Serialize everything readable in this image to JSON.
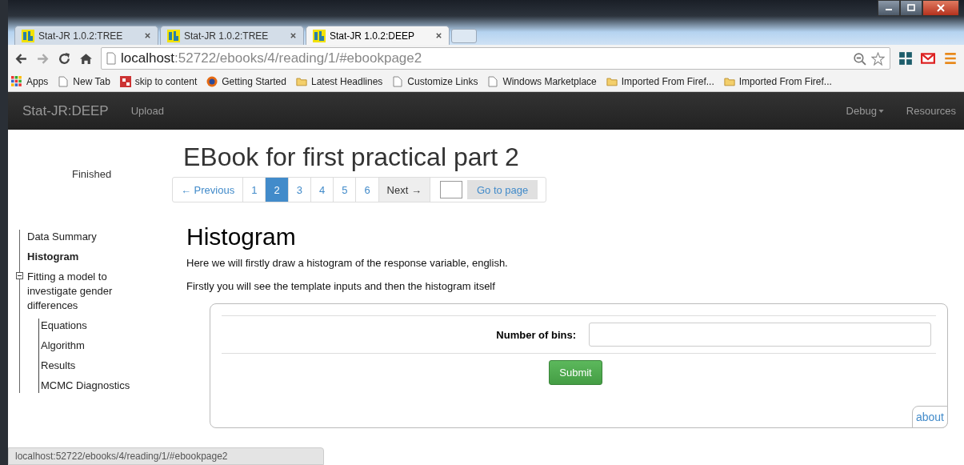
{
  "browser": {
    "tabs": [
      {
        "title": "Stat-JR 1.0.2:TREE",
        "selected": false
      },
      {
        "title": "Stat-JR 1.0.2:TREE",
        "selected": false
      },
      {
        "title": "Stat-JR 1.0.2:DEEP",
        "selected": true
      }
    ],
    "address": {
      "host": "localhost",
      "rest": ":52722/ebooks/4/reading/1/#ebookpage2"
    },
    "bookmarks": [
      {
        "label": "Apps",
        "kind": "apps"
      },
      {
        "label": "New Tab",
        "kind": "page"
      },
      {
        "label": "skip to content",
        "kind": "site"
      },
      {
        "label": "Getting Started",
        "kind": "firefox"
      },
      {
        "label": "Latest Headlines",
        "kind": "folder"
      },
      {
        "label": "Customize Links",
        "kind": "page"
      },
      {
        "label": "Windows Marketplace",
        "kind": "page"
      },
      {
        "label": "Imported From Firef...",
        "kind": "folder"
      },
      {
        "label": "Imported From Firef...",
        "kind": "folder"
      }
    ],
    "status_bar": "localhost:52722/ebooks/4/reading/1/#ebookpage2"
  },
  "navbar": {
    "brand": "Stat-JR:DEEP",
    "left": [
      "Upload"
    ],
    "right": [
      {
        "label": "Debug",
        "dropdown": true
      },
      {
        "label": "Resources",
        "dropdown": false
      }
    ]
  },
  "sidebar": {
    "status": "Finished",
    "tree": [
      {
        "label": "Data Summary",
        "selected": false
      },
      {
        "label": "Histogram",
        "selected": true
      },
      {
        "label": "Fitting a model to investigate gender differences",
        "selected": false,
        "expanded": true,
        "children": [
          {
            "label": "Equations",
            "selected": false
          },
          {
            "label": "Algorithm",
            "selected": false
          },
          {
            "label": "Results",
            "selected": false
          },
          {
            "label": "MCMC Diagnostics",
            "selected": false
          }
        ]
      }
    ]
  },
  "ebook": {
    "title": "EBook for first practical part 2",
    "pagination": [
      {
        "label": "← Previous",
        "selected": false,
        "shaded": false
      },
      {
        "label": "1",
        "selected": false,
        "shaded": false
      },
      {
        "label": "2",
        "selected": true,
        "shaded": false
      },
      {
        "label": "3",
        "selected": false,
        "shaded": false
      },
      {
        "label": "4",
        "selected": false,
        "shaded": false
      },
      {
        "label": "5",
        "selected": false,
        "shaded": false
      },
      {
        "label": "6",
        "selected": false,
        "shaded": false
      },
      {
        "label": "Next →",
        "selected": false,
        "shaded": true
      }
    ],
    "goto_button": "Go to page",
    "heading": "Histogram",
    "paragraphs": [
      "Here we will firstly draw a histogram of the response variable, english.",
      "Firstly you will see the template inputs and then the histogram itself"
    ],
    "form": {
      "field_label": "Number of bins:",
      "submit": "Submit",
      "about": "about"
    }
  }
}
